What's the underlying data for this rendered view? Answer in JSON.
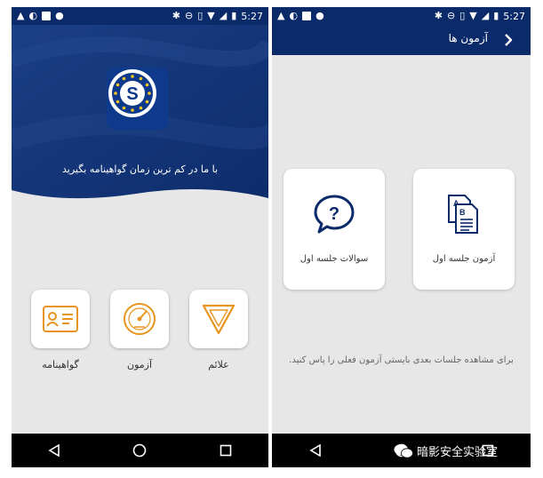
{
  "status_bar": {
    "time": "5:27"
  },
  "colors": {
    "primary": "#0b2a6a",
    "accent": "#e8941e",
    "background": "#e7e7e7"
  },
  "home": {
    "tagline": "با ما در کم ترین زمان گواهینامه بگیرید",
    "logo_letter": "S",
    "tiles": [
      {
        "label": "گواهینامه",
        "icon": "license-card-icon"
      },
      {
        "label": "آزمون",
        "icon": "speedometer-icon"
      },
      {
        "label": "علائم",
        "icon": "yield-sign-icon"
      }
    ]
  },
  "exams": {
    "title": "آزمون ها",
    "cards": [
      {
        "label": "سوالات جلسه اول",
        "icon": "question-bubble-icon"
      },
      {
        "label": "آزمون جلسه اول",
        "icon": "documents-icon"
      }
    ],
    "hint": "برای مشاهده جلسات بعدی بایستی آزمون فعلی را پاس کنید."
  },
  "watermark": "暗影安全实验室"
}
